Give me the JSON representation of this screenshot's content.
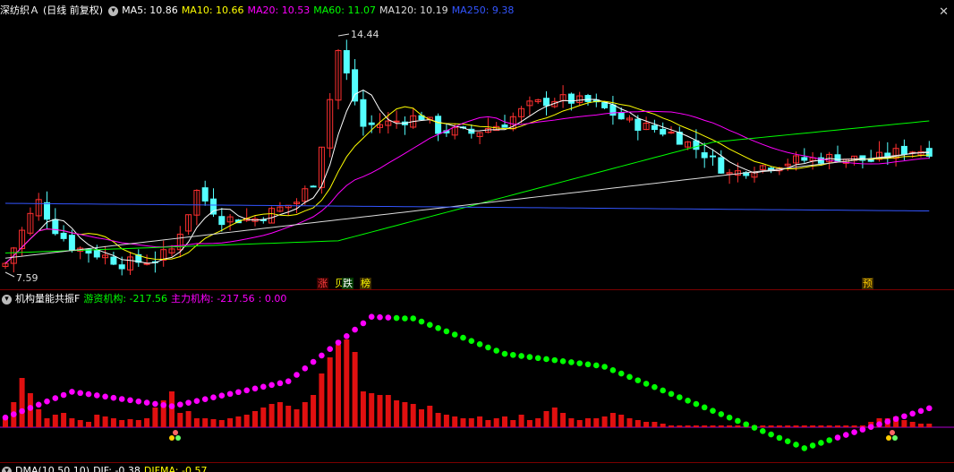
{
  "main_panel": {
    "stock_name": "深纺织Ａ",
    "period": "(日线 前复权)",
    "ma_items": [
      {
        "label": "MA5: 10.86",
        "color": "#ffffff"
      },
      {
        "label": "MA10: 10.66",
        "color": "#ffff00"
      },
      {
        "label": "MA20: 10.53",
        "color": "#ff00ff"
      },
      {
        "label": "MA60: 11.07",
        "color": "#00ff00"
      },
      {
        "label": "MA120: 10.19",
        "color": "#dddddd"
      },
      {
        "label": "MA250: 9.38",
        "color": "#3355ff"
      }
    ],
    "high_label": "14.44",
    "low_label": "7.59",
    "tags": [
      {
        "text": "涨",
        "color": "#ff4040",
        "bg": "#3a0000"
      },
      {
        "text": "贝",
        "color": "#ffff00",
        "bg": "#000000"
      },
      {
        "text": "跌",
        "color": "#ffffff",
        "bg": "#003a00"
      },
      {
        "text": "榜",
        "color": "#ffff00",
        "bg": "#3a2a00"
      },
      {
        "text": "预",
        "color": "#ffcc00",
        "bg": "#3a2a00"
      }
    ]
  },
  "indicator_panel": {
    "name": "机构量能共振F",
    "line1": "游资机构: -217.56",
    "line2": "主力机构: -217.56",
    "line3": ": 0.00",
    "colors": {
      "line1": "#00ff00",
      "line2": "#ff00ff",
      "line3": "#ff00ff"
    }
  },
  "macd_panel": {
    "name": "DMA(10,50,10)",
    "dif": "DIF: -0.38",
    "difma": "DIFMA: -0.57"
  },
  "colors": {
    "up": "#ff3030",
    "down": "#54ffff",
    "bar": "#e01010",
    "ma5": "#ffffff",
    "ma10": "#ffff00",
    "ma20": "#ff00ff",
    "ma60": "#00ff00",
    "ma120": "#dddddd",
    "ma250": "#3355ff"
  }
}
